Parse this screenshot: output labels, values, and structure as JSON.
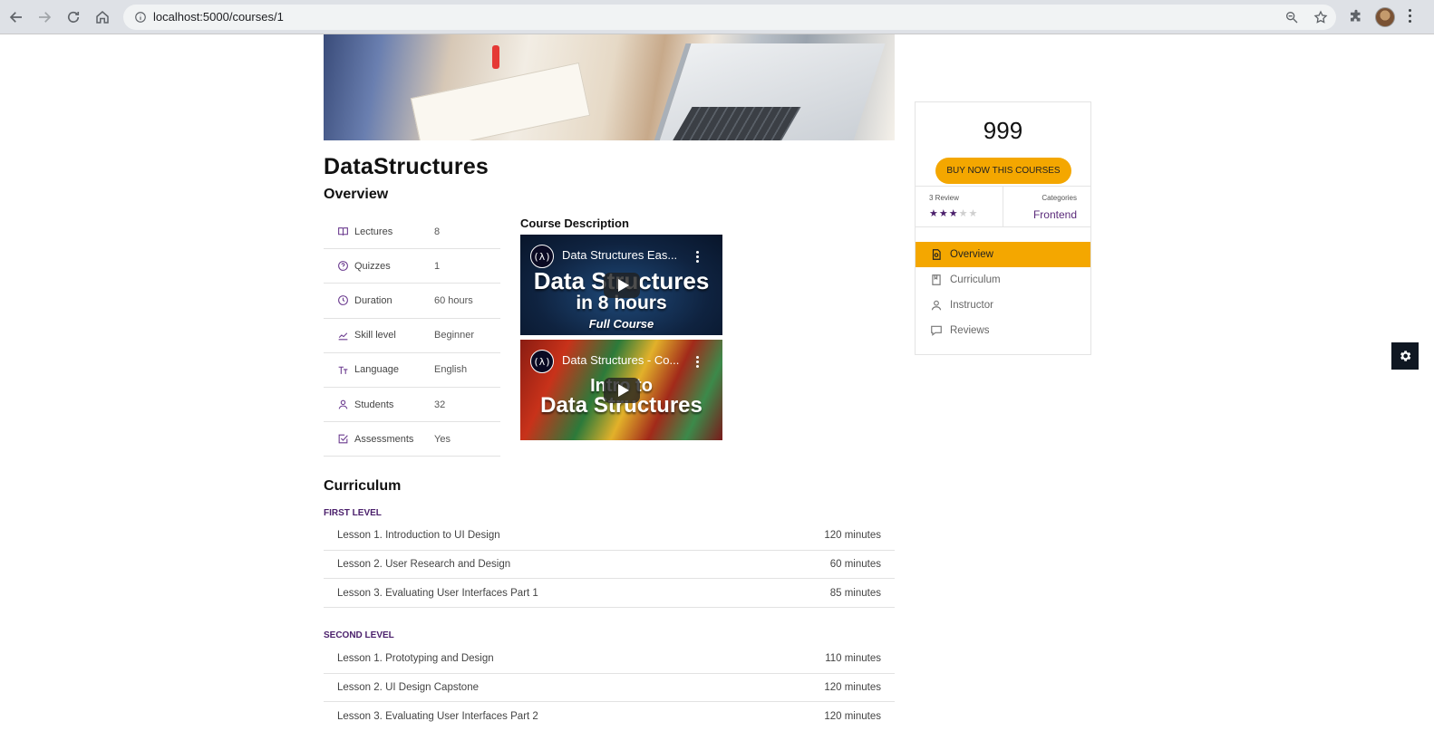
{
  "browser": {
    "url": "localhost:5000/courses/1"
  },
  "course": {
    "title": "DataStructures",
    "overview_heading": "Overview",
    "info": [
      {
        "icon": "book-open-icon",
        "label": "Lectures",
        "value": "8"
      },
      {
        "icon": "question-circle-icon",
        "label": "Quizzes",
        "value": "1"
      },
      {
        "icon": "clock-icon",
        "label": "Duration",
        "value": "60 hours"
      },
      {
        "icon": "trend-chart-icon",
        "label": "Skill level",
        "value": "Beginner"
      },
      {
        "icon": "text-size-icon",
        "label": "Language",
        "value": "English"
      },
      {
        "icon": "user-icon",
        "label": "Students",
        "value": "32"
      },
      {
        "icon": "checkbox-icon",
        "label": "Assessments",
        "value": "Yes"
      }
    ],
    "description_heading": "Course Description",
    "videos": [
      {
        "title": "Data Structures Eas...",
        "line1": "Data Structures",
        "line2": "in 8 hours",
        "line3": "Full Course"
      },
      {
        "title": "Data Structures - Co...",
        "line1": "Intro to",
        "line2": "Data Structures"
      }
    ]
  },
  "curriculum": {
    "heading": "Curriculum",
    "levels": [
      {
        "name": "FIRST LEVEL",
        "lessons": [
          {
            "title": "Lesson 1. Introduction to UI Design",
            "duration": "120 minutes"
          },
          {
            "title": "Lesson 2. User Research and Design",
            "duration": "60 minutes"
          },
          {
            "title": "Lesson 3. Evaluating User Interfaces Part 1",
            "duration": "85 minutes"
          }
        ]
      },
      {
        "name": "SECOND LEVEL",
        "lessons": [
          {
            "title": "Lesson 1. Prototyping and Design",
            "duration": "110 minutes"
          },
          {
            "title": "Lesson 2. UI Design Capstone",
            "duration": "120 minutes"
          },
          {
            "title": "Lesson 3. Evaluating User Interfaces Part 2",
            "duration": "120 minutes"
          }
        ]
      }
    ]
  },
  "sidebar": {
    "price": "999",
    "buy_label": "BUY NOW THIS COURSES",
    "review_label": "3 Review",
    "rating": 3,
    "rating_max": 5,
    "categories_label": "Categories",
    "category": "Frontend",
    "menu": [
      {
        "icon": "document-icon",
        "label": "Overview",
        "active": true
      },
      {
        "icon": "bookmark-book-icon",
        "label": "Curriculum",
        "active": false
      },
      {
        "icon": "user-icon",
        "label": "Instructor",
        "active": false
      },
      {
        "icon": "chat-bubble-icon",
        "label": "Reviews",
        "active": false
      }
    ]
  },
  "colors": {
    "accent": "#f4a700",
    "brand_purple": "#4a1f6b"
  }
}
